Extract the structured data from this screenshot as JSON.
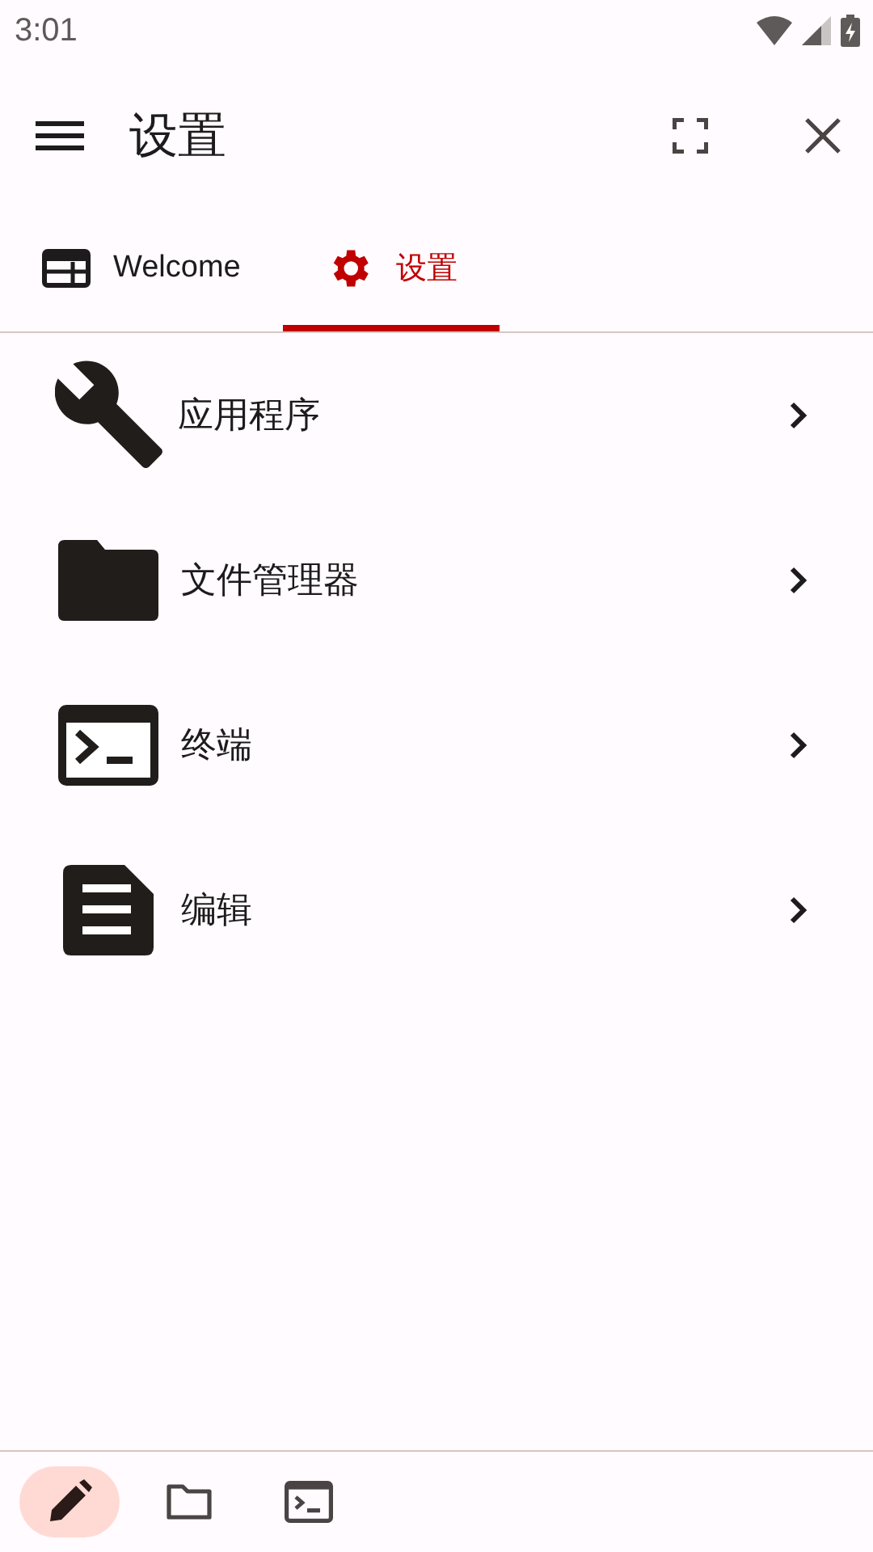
{
  "status_bar": {
    "time": "3:01"
  },
  "app_bar": {
    "title": "设置"
  },
  "tabs": [
    {
      "label": "Welcome",
      "kind": "window",
      "selected": false
    },
    {
      "label": "设置",
      "kind": "gear",
      "selected": true
    }
  ],
  "items": [
    {
      "label": "应用程序",
      "kind": "wrench"
    },
    {
      "label": "文件管理器",
      "kind": "folder"
    },
    {
      "label": "终端",
      "kind": "terminal"
    },
    {
      "label": "编辑",
      "kind": "document"
    }
  ],
  "bottom_nav": [
    {
      "kind": "pencil",
      "selected": true
    },
    {
      "kind": "folder",
      "selected": false
    },
    {
      "kind": "terminal",
      "selected": false
    }
  ]
}
